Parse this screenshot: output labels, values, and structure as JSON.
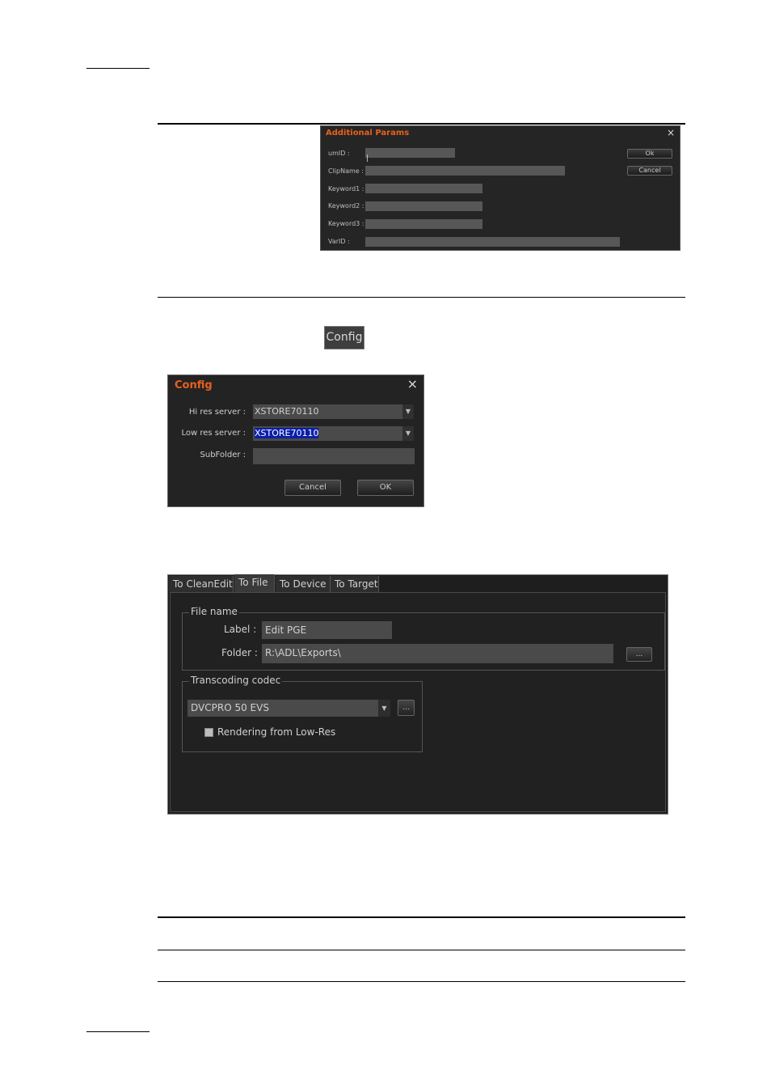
{
  "additional_params": {
    "title": "Additional Params",
    "close": "×",
    "fields": [
      "umID :",
      "ClipName :",
      "Keyword1 :",
      "Keyword2 :",
      "Keyword3 :",
      "VarID :"
    ],
    "umid_value": "|",
    "ok": "Ok",
    "cancel": "Cancel"
  },
  "config_button": {
    "label": "Config"
  },
  "config_dialog": {
    "title": "Config",
    "close": "×",
    "hires_label": "Hi res server :",
    "hires_value": "XSTORE70110",
    "lowres_label": "Low res server :",
    "lowres_value": "XSTORE70110",
    "subfolder_label": "SubFolder :",
    "cancel": "Cancel",
    "ok": "OK"
  },
  "export_panel": {
    "tabs": [
      "To CleanEdit",
      "To File",
      "To Device",
      "To Target"
    ],
    "active_tab": "To File",
    "file_name_group": "File name",
    "label_label": "Label :",
    "label_value": "Edit PGE",
    "folder_label": "Folder :",
    "folder_value": "R:\\ADL\\Exports\\",
    "browse": "...",
    "codec_group": "Transcoding codec",
    "codec_value": "DVCPRO 50 EVS",
    "codec_more": "...",
    "render_lowres": "Rendering from Low-Res",
    "render_lowres_checked": false
  },
  "colors": {
    "accent": "#e8601c",
    "dialog_bg": "#252525",
    "field_bg": "#575757",
    "selection": "#0a1fa8"
  }
}
